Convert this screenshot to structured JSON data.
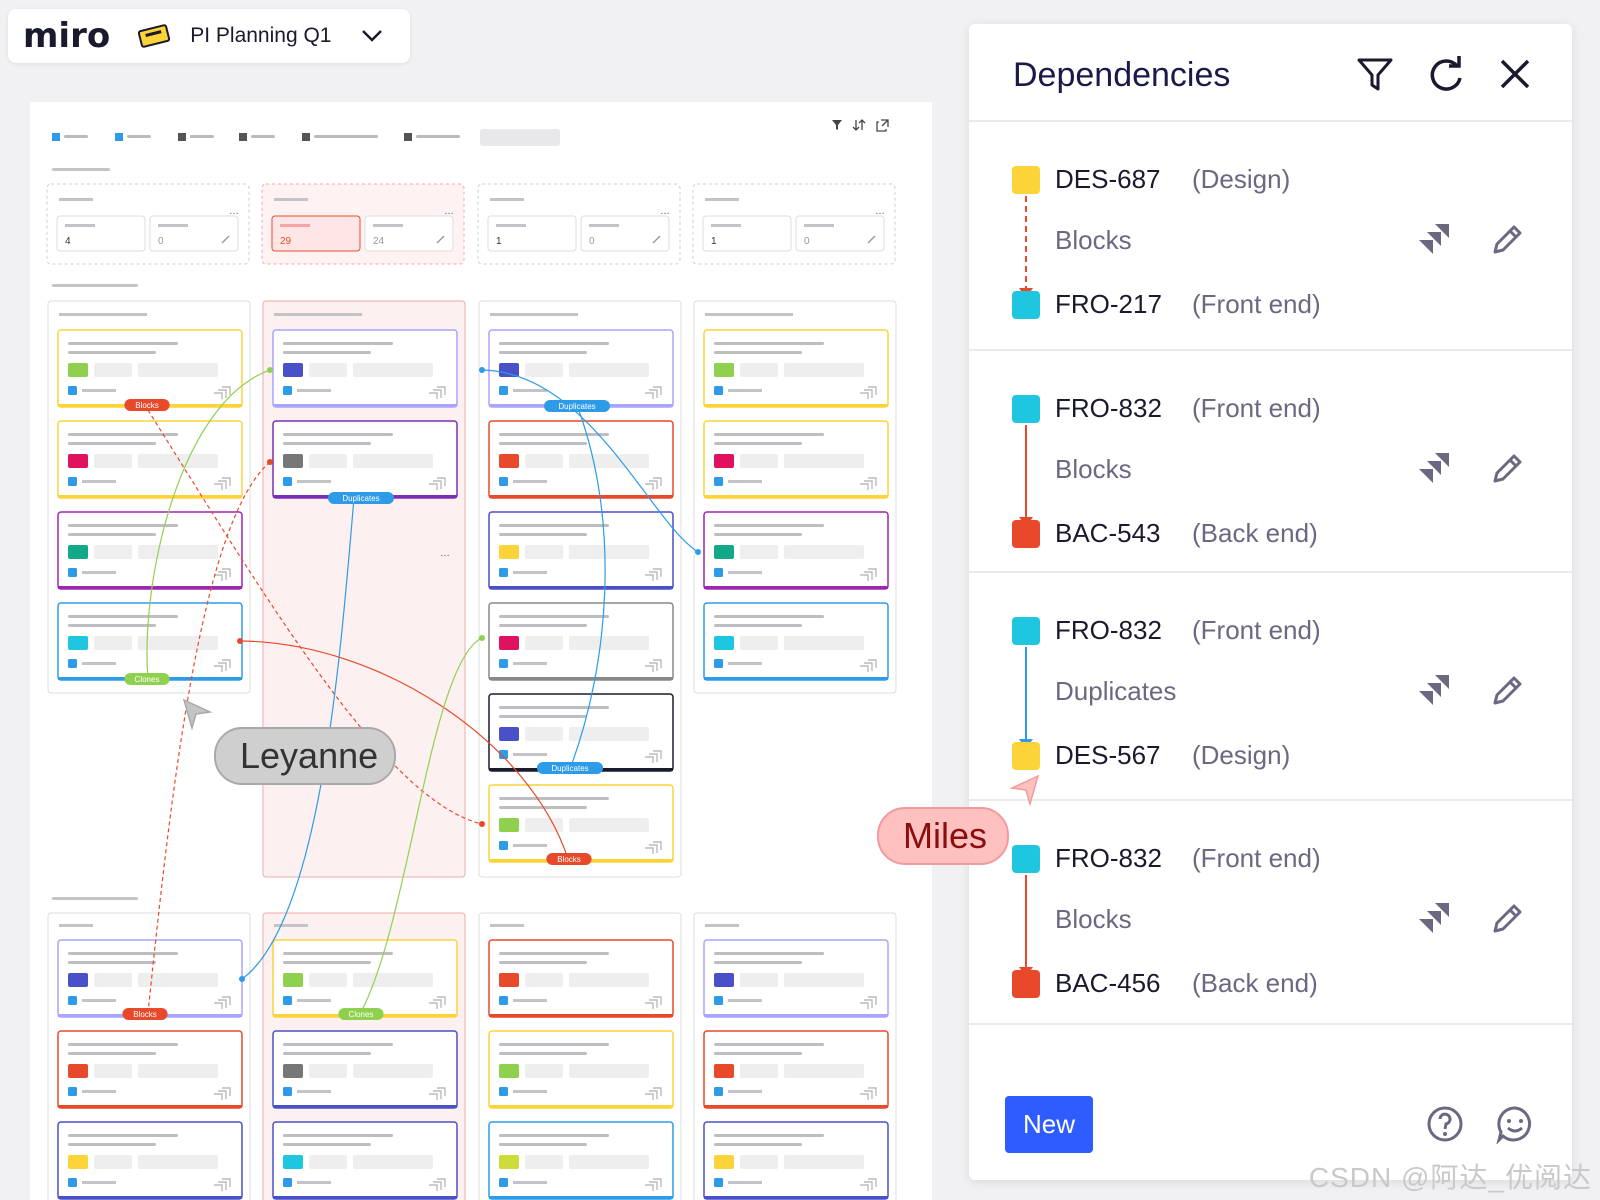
{
  "app": {
    "logo": "miro",
    "board_title": "PI Planning Q1"
  },
  "board": {
    "summary_values": [
      "4",
      "0",
      "29",
      "24",
      "1",
      "0",
      "1",
      "0"
    ],
    "badges": {
      "blocks": "Blocks",
      "duplicates": "Duplicates",
      "clones": "Clones"
    }
  },
  "cursors": {
    "leyanne": "Leyanne",
    "miles": "Miles"
  },
  "panel": {
    "title": "Dependencies",
    "dependencies": [
      {
        "from_key": "DES-687",
        "from_team": "(Design)",
        "relation": "Blocks",
        "to_key": "FRO-217",
        "to_team": "(Front end)"
      },
      {
        "from_key": "FRO-832",
        "from_team": "(Front end)",
        "relation": "Blocks",
        "to_key": "BAC-543",
        "to_team": "(Back end)"
      },
      {
        "from_key": "FRO-832",
        "from_team": "(Front end)",
        "relation": "Duplicates",
        "to_key": "DES-567",
        "to_team": "(Design)"
      },
      {
        "from_key": "FRO-832",
        "from_team": "(Front end)",
        "relation": "Blocks",
        "to_key": "BAC-456",
        "to_team": "(Back end)"
      }
    ],
    "new_label": "New"
  },
  "colors": {
    "blocks": "#e8492a",
    "duplicates": "#2d9be8",
    "clones": "#8fd14f",
    "accent": "#2f5cff",
    "design": "#fcd43a",
    "frontend": "#1fc6e0",
    "backend": "#e8492a"
  },
  "watermark": "CSDN @阿达_优阅达"
}
